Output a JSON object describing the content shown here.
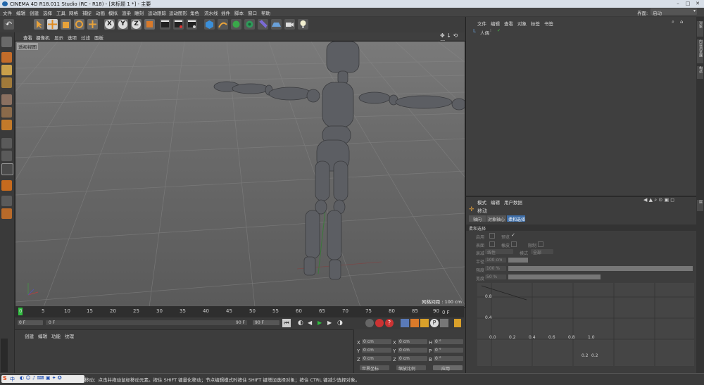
{
  "titlebar": {
    "title": "CINEMA 4D R18.011 Studio (RC - R18) - [未标题 1 *] - 主要"
  },
  "menubar": {
    "items": [
      "文件",
      "编辑",
      "创建",
      "选择",
      "工具",
      "网格",
      "捕捉",
      "动画",
      "模拟",
      "渲染",
      "雕刻",
      "运动跟踪",
      "运动图形",
      "角色",
      "流水线",
      "插件",
      "脚本",
      "窗口",
      "帮助"
    ],
    "layout_label": "界面:",
    "layout_value": "启动"
  },
  "toolbar": {
    "x": "X",
    "y": "Y",
    "z": "Z"
  },
  "viewport": {
    "menu": [
      "查看",
      "摄像机",
      "显示",
      "选项",
      "过滤",
      "面板"
    ],
    "camera_label": "透视视图",
    "grid_spacing": "网格间距 : 100 cm"
  },
  "timeline": {
    "ticks": [
      "0",
      "5",
      "10",
      "15",
      "20",
      "25",
      "30",
      "35",
      "40",
      "45",
      "50",
      "55",
      "60",
      "65",
      "70",
      "75",
      "80",
      "85",
      "90"
    ],
    "end_label": "0 F"
  },
  "playbar": {
    "start": "0 F",
    "current": "0 F",
    "range_end": "90 F",
    "end": "90 F"
  },
  "materials": {
    "menu": [
      "创建",
      "编辑",
      "功能",
      "纹理"
    ]
  },
  "coordinates": {
    "rows": [
      {
        "a": "X",
        "av": "0 cm",
        "b": "X",
        "bv": "0 cm",
        "c": "H",
        "cv": "0 °"
      },
      {
        "a": "Y",
        "av": "0 cm",
        "b": "Y",
        "bv": "0 cm",
        "c": "P",
        "cv": "0 °"
      },
      {
        "a": "Z",
        "av": "0 cm",
        "b": "Z",
        "bv": "0 cm",
        "c": "B",
        "cv": "0 °"
      }
    ],
    "mode1": "世界坐标",
    "mode2": "缩放比例",
    "apply": "应用"
  },
  "objects": {
    "menu": [
      "文件",
      "编辑",
      "查看",
      "对象",
      "标签",
      "书签"
    ],
    "item": "人偶"
  },
  "attributes": {
    "menu": [
      "模式",
      "编辑",
      "用户数据"
    ],
    "tool_name": "移动",
    "tabs": [
      "轴向",
      "对象轴心",
      "柔和选择"
    ],
    "section": "柔和选择",
    "enable": "启用",
    "preview": "预览",
    "surface": "表面",
    "rubber": "橡皮",
    "restrict": "限制",
    "mode_label": "模式",
    "mode_value": "全部",
    "falloff_label": "衰减",
    "falloff_value": "线性",
    "radius_label": "半径",
    "radius_value": "100 cm",
    "strength_label": "强度",
    "strength_value": "100 %",
    "width_label": "宽度",
    "width_value": "50 %",
    "graph_y1": "0.8",
    "graph_y2": "0.4",
    "graph_x": [
      "0.0",
      "0.2",
      "0.4",
      "0.6",
      "0.8",
      "1.0"
    ],
    "graph_bottom": [
      "0.2",
      "0.2"
    ]
  },
  "rightstrip": [
    "对象",
    "内容浏览器",
    "构造",
    "层"
  ],
  "statusbar": {
    "text": "移动：点击并拖动鼠标移动元素。按住 SHIFT 键量化移动；节点编辑模式时按住 SHIFT 键增加选择对象；按住 CTRL 键减少选择对象。",
    "ime": "中"
  }
}
